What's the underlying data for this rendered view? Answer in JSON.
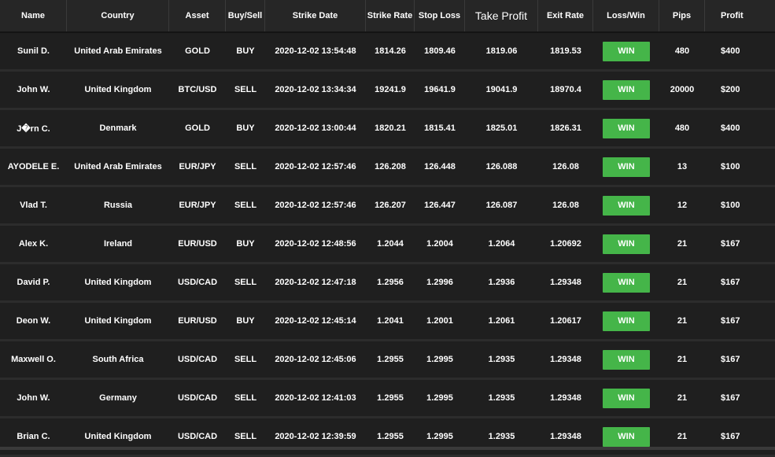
{
  "headers": {
    "name": "Name",
    "country": "Country",
    "asset": "Asset",
    "buy_sell": "Buy/Sell",
    "strike_date": "Strike Date",
    "strike_rate": "Strike Rate",
    "stop_loss": "Stop Loss",
    "take_profit": "Take Profit",
    "exit_rate": "Exit Rate",
    "loss_win": "Loss/Win",
    "pips": "Pips",
    "profit": "Profit"
  },
  "colors": {
    "win": "#45b549",
    "background": "#1f1f1f",
    "header": "#262626"
  },
  "rows": [
    {
      "name": "Sunil D.",
      "country": "United Arab Emirates",
      "asset": "GOLD",
      "buy_sell": "BUY",
      "strike_date": "2020-12-02 13:54:48",
      "strike_rate": "1814.26",
      "stop_loss": "1809.46",
      "take_profit": "1819.06",
      "exit_rate": "1819.53",
      "result": "WIN",
      "pips": "480",
      "profit": "$400"
    },
    {
      "name": "John W.",
      "country": "United Kingdom",
      "asset": "BTC/USD",
      "buy_sell": "SELL",
      "strike_date": "2020-12-02 13:34:34",
      "strike_rate": "19241.9",
      "stop_loss": "19641.9",
      "take_profit": "19041.9",
      "exit_rate": "18970.4",
      "result": "WIN",
      "pips": "20000",
      "profit": "$200"
    },
    {
      "name": "J�rn C.",
      "country": "Denmark",
      "asset": "GOLD",
      "buy_sell": "BUY",
      "strike_date": "2020-12-02 13:00:44",
      "strike_rate": "1820.21",
      "stop_loss": "1815.41",
      "take_profit": "1825.01",
      "exit_rate": "1826.31",
      "result": "WIN",
      "pips": "480",
      "profit": "$400"
    },
    {
      "name": "AYODELE E.",
      "country": "United Arab Emirates",
      "asset": "EUR/JPY",
      "buy_sell": "SELL",
      "strike_date": "2020-12-02 12:57:46",
      "strike_rate": "126.208",
      "stop_loss": "126.448",
      "take_profit": "126.088",
      "exit_rate": "126.08",
      "result": "WIN",
      "pips": "13",
      "profit": "$100"
    },
    {
      "name": "Vlad T.",
      "country": "Russia",
      "asset": "EUR/JPY",
      "buy_sell": "SELL",
      "strike_date": "2020-12-02 12:57:46",
      "strike_rate": "126.207",
      "stop_loss": "126.447",
      "take_profit": "126.087",
      "exit_rate": "126.08",
      "result": "WIN",
      "pips": "12",
      "profit": "$100"
    },
    {
      "name": "Alex K.",
      "country": "Ireland",
      "asset": "EUR/USD",
      "buy_sell": "BUY",
      "strike_date": "2020-12-02 12:48:56",
      "strike_rate": "1.2044",
      "stop_loss": "1.2004",
      "take_profit": "1.2064",
      "exit_rate": "1.20692",
      "result": "WIN",
      "pips": "21",
      "profit": "$167"
    },
    {
      "name": "David P.",
      "country": "United Kingdom",
      "asset": "USD/CAD",
      "buy_sell": "SELL",
      "strike_date": "2020-12-02 12:47:18",
      "strike_rate": "1.2956",
      "stop_loss": "1.2996",
      "take_profit": "1.2936",
      "exit_rate": "1.29348",
      "result": "WIN",
      "pips": "21",
      "profit": "$167"
    },
    {
      "name": "Deon W.",
      "country": "United Kingdom",
      "asset": "EUR/USD",
      "buy_sell": "BUY",
      "strike_date": "2020-12-02 12:45:14",
      "strike_rate": "1.2041",
      "stop_loss": "1.2001",
      "take_profit": "1.2061",
      "exit_rate": "1.20617",
      "result": "WIN",
      "pips": "21",
      "profit": "$167"
    },
    {
      "name": "Maxwell O.",
      "country": "South Africa",
      "asset": "USD/CAD",
      "buy_sell": "SELL",
      "strike_date": "2020-12-02 12:45:06",
      "strike_rate": "1.2955",
      "stop_loss": "1.2995",
      "take_profit": "1.2935",
      "exit_rate": "1.29348",
      "result": "WIN",
      "pips": "21",
      "profit": "$167"
    },
    {
      "name": "John W.",
      "country": "Germany",
      "asset": "USD/CAD",
      "buy_sell": "SELL",
      "strike_date": "2020-12-02 12:41:03",
      "strike_rate": "1.2955",
      "stop_loss": "1.2995",
      "take_profit": "1.2935",
      "exit_rate": "1.29348",
      "result": "WIN",
      "pips": "21",
      "profit": "$167"
    },
    {
      "name": "Brian C.",
      "country": "United Kingdom",
      "asset": "USD/CAD",
      "buy_sell": "SELL",
      "strike_date": "2020-12-02 12:39:59",
      "strike_rate": "1.2955",
      "stop_loss": "1.2995",
      "take_profit": "1.2935",
      "exit_rate": "1.29348",
      "result": "WIN",
      "pips": "21",
      "profit": "$167"
    }
  ]
}
